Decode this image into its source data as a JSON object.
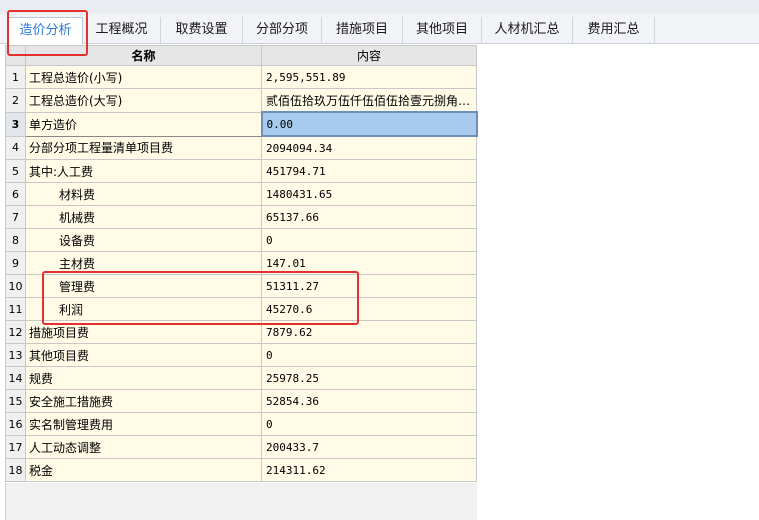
{
  "tabs": [
    "造价分析",
    "工程概况",
    "取费设置",
    "分部分项",
    "措施项目",
    "其他项目",
    "人材机汇总",
    "费用汇总"
  ],
  "table": {
    "headers": {
      "name": "名称",
      "content": "内容"
    },
    "rows": [
      {
        "idx": "1",
        "name": "工程总造价(小写)",
        "value": "2,595,551.89"
      },
      {
        "idx": "2",
        "name": "工程总造价(大写)",
        "value": "贰佰伍拾玖万伍仟伍佰伍拾壹元捌角…"
      },
      {
        "idx": "3",
        "name": "单方造价",
        "value": "0.00"
      },
      {
        "idx": "4",
        "name": "分部分项工程量清单项目费",
        "value": "2094094.34"
      },
      {
        "idx": "5",
        "name": "其中:人工费",
        "value": "451794.71"
      },
      {
        "idx": "6",
        "name": "材料费",
        "value": "1480431.65"
      },
      {
        "idx": "7",
        "name": "机械费",
        "value": "65137.66"
      },
      {
        "idx": "8",
        "name": "设备费",
        "value": "0"
      },
      {
        "idx": "9",
        "name": "主材费",
        "value": "147.01"
      },
      {
        "idx": "10",
        "name": "管理费",
        "value": "51311.27"
      },
      {
        "idx": "11",
        "name": "利润",
        "value": "45270.6"
      },
      {
        "idx": "12",
        "name": "措施项目费",
        "value": "7879.62"
      },
      {
        "idx": "13",
        "name": "其他项目费",
        "value": "0"
      },
      {
        "idx": "14",
        "name": "规费",
        "value": "25978.25"
      },
      {
        "idx": "15",
        "name": "安全施工措施费",
        "value": "52854.36"
      },
      {
        "idx": "16",
        "name": "实名制管理费用",
        "value": "0"
      },
      {
        "idx": "17",
        "name": "人工动态调整",
        "value": "200433.7"
      },
      {
        "idx": "18",
        "name": "税金",
        "value": "214311.62"
      }
    ]
  },
  "colors": {
    "active_tab_text": "#2b78d6",
    "highlight": "#e43030",
    "selected_cell": "#a9cbef"
  }
}
